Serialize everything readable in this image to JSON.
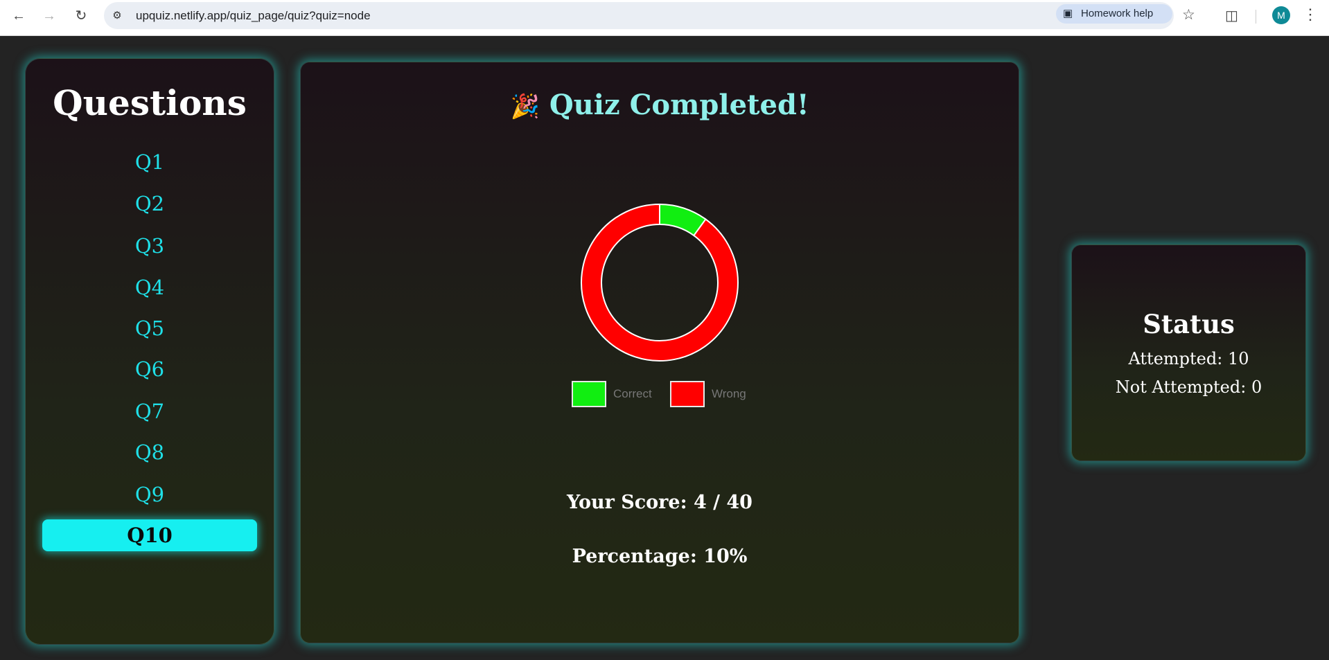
{
  "browser": {
    "url": "upquiz.netlify.app/quiz_page/quiz?quiz=node",
    "homework_help": "Homework help",
    "avatar_letter": "M",
    "icons": [
      "back-icon",
      "forward-icon",
      "reload-icon",
      "site-info-icon",
      "lens-icon",
      "star-icon",
      "extensions-icon",
      "kebab-menu-icon"
    ]
  },
  "sidebar": {
    "title": "Questions",
    "items": [
      {
        "label": "Q1",
        "active": false
      },
      {
        "label": "Q2",
        "active": false
      },
      {
        "label": "Q3",
        "active": false
      },
      {
        "label": "Q4",
        "active": false
      },
      {
        "label": "Q5",
        "active": false
      },
      {
        "label": "Q6",
        "active": false
      },
      {
        "label": "Q7",
        "active": false
      },
      {
        "label": "Q8",
        "active": false
      },
      {
        "label": "Q9",
        "active": false
      },
      {
        "label": "Q10",
        "active": true
      }
    ]
  },
  "main": {
    "emoji": "🎉",
    "title": "Quiz Completed!",
    "score_text": "Your Score: 4 / 40",
    "percentage_text": "Percentage: 10%"
  },
  "chart_data": {
    "type": "pie",
    "variant": "doughnut",
    "labels": [
      "Correct",
      "Wrong"
    ],
    "values": [
      1,
      9
    ],
    "colors": [
      "#11ee11",
      "#ff0000"
    ],
    "legend": "bottom"
  },
  "status": {
    "title": "Status",
    "attempted": "Attempted: 10",
    "not_attempted": "Not Attempted: 0"
  },
  "colors": {
    "accent": "#16eff0",
    "title_teal": "#8ff0ea",
    "background": "#232323"
  }
}
